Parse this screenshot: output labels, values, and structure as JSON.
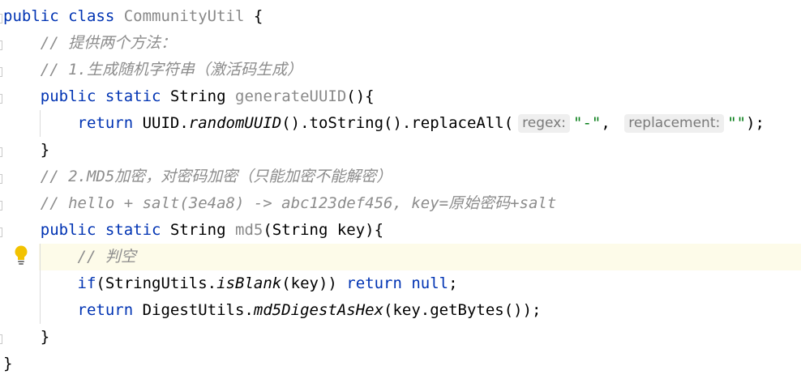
{
  "editor": {
    "lines": [
      {
        "tokens": [
          {
            "t": "public class ",
            "c": "kw"
          },
          {
            "t": "CommunityUtil ",
            "c": "dim"
          },
          {
            "t": "{",
            "c": "cls"
          }
        ]
      },
      {
        "tokens": [
          {
            "t": "    ",
            "c": ""
          },
          {
            "t": "// 提供两个方法：",
            "c": "cm"
          }
        ]
      },
      {
        "tokens": [
          {
            "t": "    ",
            "c": ""
          },
          {
            "t": "// 1.生成随机字符串（激活码生成）",
            "c": "cm"
          }
        ]
      },
      {
        "tokens": [
          {
            "t": "    ",
            "c": ""
          },
          {
            "t": "public static ",
            "c": "kw"
          },
          {
            "t": "String ",
            "c": "cls"
          },
          {
            "t": "generateUUID",
            "c": "dim"
          },
          {
            "t": "(){",
            "c": "cls"
          }
        ]
      },
      {
        "tokens": [
          {
            "t": "        ",
            "c": ""
          },
          {
            "t": "return ",
            "c": "kw"
          },
          {
            "t": "UUID.",
            "c": "cls"
          },
          {
            "t": "randomUUID",
            "c": "cls it"
          },
          {
            "t": "().toString().replaceAll(",
            "c": "cls"
          },
          {
            "hint": "regex:"
          },
          {
            "t": "\"-\"",
            "c": "str"
          },
          {
            "t": ", ",
            "c": "cls"
          },
          {
            "hint": "replacement:"
          },
          {
            "t": "\"\"",
            "c": "str"
          },
          {
            "t": ");",
            "c": "cls"
          }
        ]
      },
      {
        "tokens": [
          {
            "t": "    ",
            "c": ""
          },
          {
            "t": "}",
            "c": "cls"
          }
        ]
      },
      {
        "tokens": [
          {
            "t": "    ",
            "c": ""
          },
          {
            "t": "// 2.MD5加密，对密码加密（只能加密不能解密）",
            "c": "cm"
          }
        ]
      },
      {
        "tokens": [
          {
            "t": "    ",
            "c": ""
          },
          {
            "t": "// hello + salt(3e4a8) -> abc123def456, key=原始密码+salt",
            "c": "cm"
          }
        ]
      },
      {
        "tokens": [
          {
            "t": "    ",
            "c": ""
          },
          {
            "t": "public static ",
            "c": "kw"
          },
          {
            "t": "String ",
            "c": "cls"
          },
          {
            "t": "md5",
            "c": "dim"
          },
          {
            "t": "(String key){",
            "c": "cls"
          }
        ]
      },
      {
        "tokens": [
          {
            "t": "        ",
            "c": ""
          },
          {
            "t": "// 判空",
            "c": "cm"
          }
        ]
      },
      {
        "tokens": [
          {
            "t": "        ",
            "c": ""
          },
          {
            "t": "if",
            "c": "kw"
          },
          {
            "t": "(StringUtils.",
            "c": "cls"
          },
          {
            "t": "isBlank",
            "c": "cls it"
          },
          {
            "t": "(key)) ",
            "c": "cls"
          },
          {
            "t": "return null",
            "c": "kw"
          },
          {
            "t": ";",
            "c": "cls"
          }
        ]
      },
      {
        "tokens": [
          {
            "t": "        ",
            "c": ""
          },
          {
            "t": "return ",
            "c": "kw"
          },
          {
            "t": "DigestUtils.",
            "c": "cls"
          },
          {
            "t": "md5DigestAsHex",
            "c": "cls it"
          },
          {
            "t": "(key.getBytes());",
            "c": "cls"
          }
        ]
      },
      {
        "tokens": [
          {
            "t": "    ",
            "c": ""
          },
          {
            "t": "}",
            "c": "cls"
          }
        ]
      },
      {
        "tokens": [
          {
            "t": "}",
            "c": "cls"
          }
        ]
      }
    ],
    "highlighted_line": 9,
    "gutter_icon": "lightbulb-icon",
    "colors": {
      "keyword": "#0033b3",
      "string": "#067d17",
      "comment": "#8c8c8c",
      "text": "#080808",
      "highlight": "#fdfbe9",
      "hint_bg": "#efefef"
    }
  }
}
